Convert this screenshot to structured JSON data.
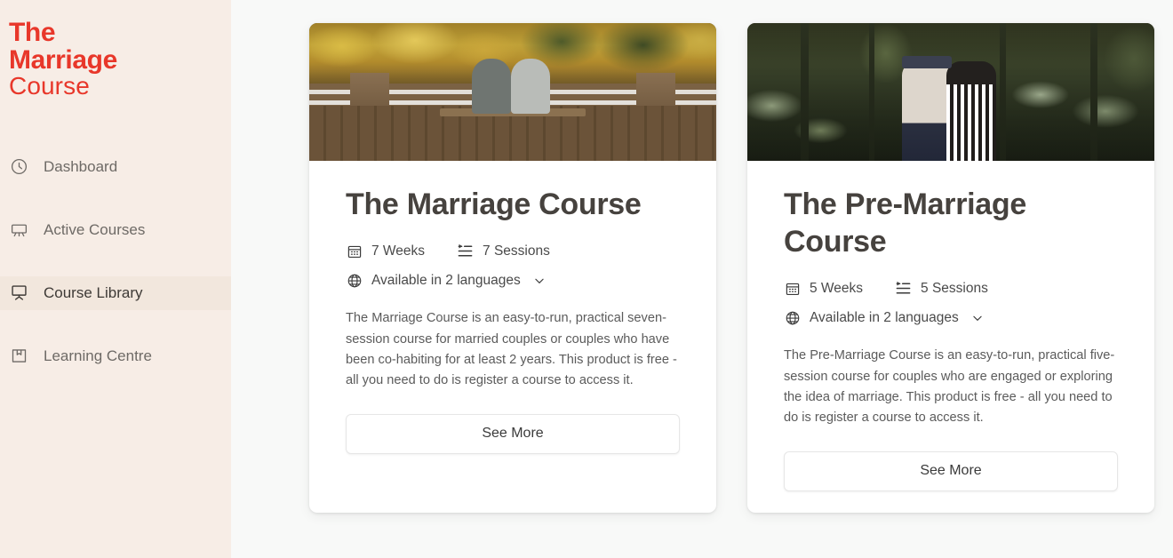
{
  "sidebar": {
    "logo": {
      "line1": "The",
      "line2": "Marriage",
      "line3": "Course",
      "color": "#E8372A"
    },
    "background": "#F7EDE6",
    "active_background": "#F2E7DD",
    "items": [
      {
        "label": "Dashboard",
        "icon": "clock-icon",
        "active": false
      },
      {
        "label": "Active Courses",
        "icon": "presentation-icon",
        "active": false
      },
      {
        "label": "Course Library",
        "icon": "projector-icon",
        "active": true
      },
      {
        "label": "Learning Centre",
        "icon": "book-icon",
        "active": false
      }
    ]
  },
  "main": {
    "background": "#F8F9F8",
    "cards": [
      {
        "title": "The Marriage Course",
        "image_alt": "Couple sitting on a wooden bench on a lakeside deck with autumn trees",
        "weeks": "7 Weeks",
        "sessions": "7 Sessions",
        "languages": "Available in 2 languages",
        "description": "The Marriage Course is an easy-to-run, practical seven-session course for married couples or couples who have been co-habiting for at least 2 years. This product is free - all you need to do is register a course to access it.",
        "button": "See More"
      },
      {
        "title": "The Pre-Marriage Course",
        "image_alt": "Couple walking arm in arm through a green forest garden",
        "weeks": "5 Weeks",
        "sessions": "5 Sessions",
        "languages": "Available in 2 languages",
        "description": "The Pre-Marriage Course is an easy-to-run, practical five-session course for couples who are engaged or exploring the idea of marriage. This product is free - all you need to do is register a course to access it.",
        "button": "See More"
      }
    ]
  }
}
